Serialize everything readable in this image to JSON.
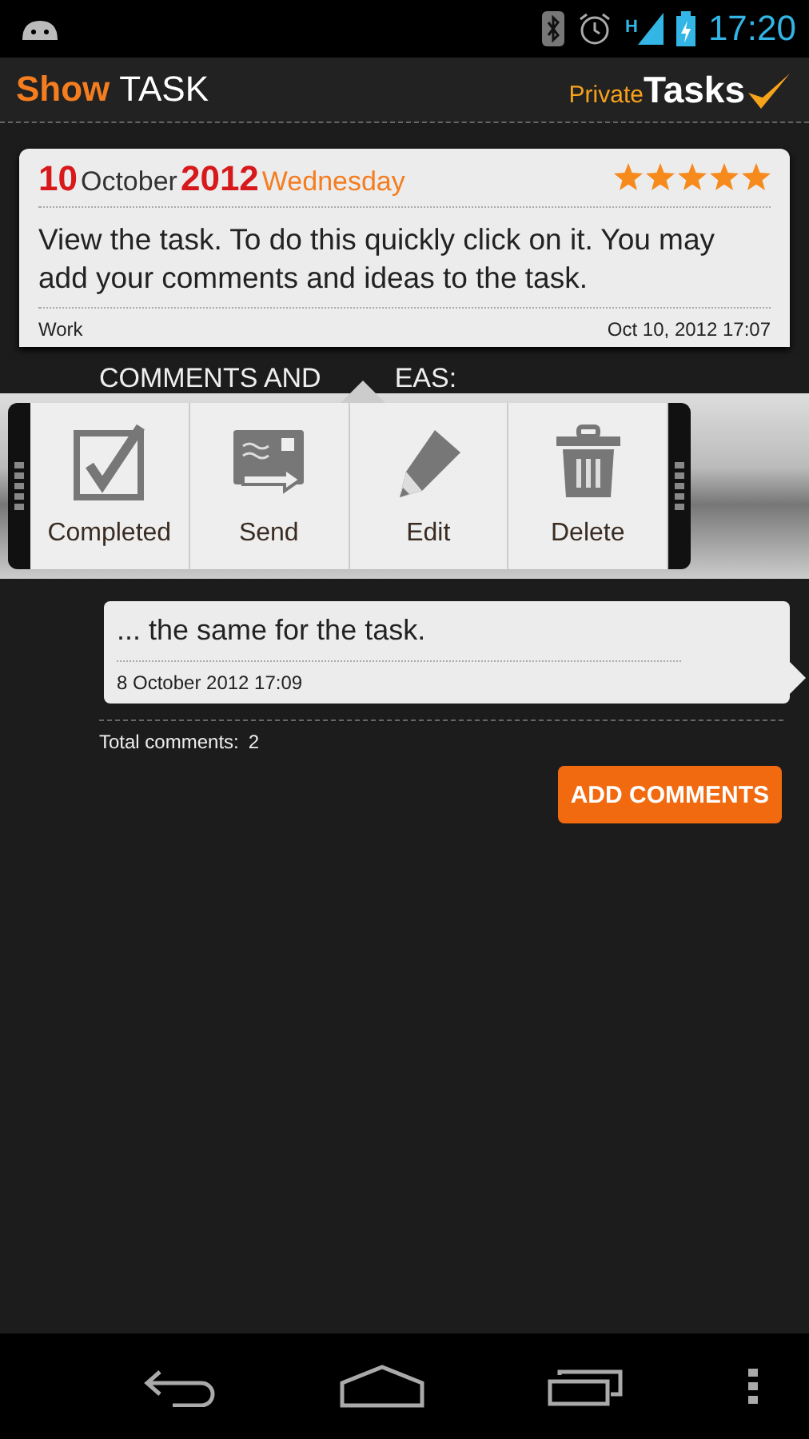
{
  "status_bar": {
    "time": "17:20",
    "network": "H"
  },
  "header": {
    "title_accent": "Show",
    "title": "TASK",
    "logo_small": "Private",
    "logo_big": "Tasks"
  },
  "task": {
    "day": "10",
    "month": "October",
    "year": "2012",
    "weekday": "Wednesday",
    "stars": 5,
    "text": "View the task. To do this quickly click on it. You may add your comments and ideas to the task.",
    "category": "Work",
    "created": "Oct 10, 2012 17:07"
  },
  "comments_heading": [
    "COMMENTS AND",
    "EAS:"
  ],
  "popup_menu": [
    {
      "kind": "check",
      "label": "Completed"
    },
    {
      "kind": "send",
      "label": "Send"
    },
    {
      "kind": "edit",
      "label": "Edit"
    },
    {
      "kind": "delete",
      "label": "Delete"
    }
  ],
  "comments": [
    {
      "text": "... the same for the task.",
      "date": "8 October 2012 17:09"
    }
  ],
  "total_label": "Total comments:",
  "total": "2",
  "add_button": "ADD COMMENTS"
}
